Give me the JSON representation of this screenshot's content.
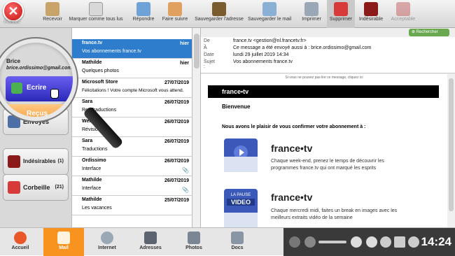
{
  "toolbar": {
    "close_label": "Fermer",
    "items": [
      {
        "label": "Recevoir",
        "icon": "receive-icon",
        "enabled": true
      },
      {
        "label": "Marquer comme tous lus",
        "icon": "mark-read-icon",
        "enabled": true
      },
      {
        "label": "Répondre",
        "icon": "reply-icon",
        "enabled": true
      },
      {
        "label": "Faire suivre",
        "icon": "forward-icon",
        "enabled": true
      },
      {
        "label": "Sauvegarder l'adresse",
        "icon": "save-address-icon",
        "enabled": true
      },
      {
        "label": "Sauvegarder le mail",
        "icon": "save-mail-icon",
        "enabled": true
      },
      {
        "label": "Imprimer",
        "icon": "printer-icon",
        "enabled": true
      },
      {
        "label": "Supprimer",
        "icon": "trash-icon",
        "enabled": true
      },
      {
        "label": "Indésirable",
        "icon": "spam-icon",
        "enabled": true
      },
      {
        "label": "Acceptable",
        "icon": "not-spam-icon",
        "enabled": false
      }
    ]
  },
  "account": {
    "name": "Brice",
    "email": "brice.ordissimo@gmail.com"
  },
  "folders": {
    "ecrire": "Ecrire",
    "recus": "Reçus",
    "envoyes": "Envoyés",
    "indesirables": "Indésirables",
    "indesirables_count": "(1)",
    "corbeille": "Corbeille",
    "corbeille_count": "(21)"
  },
  "mails": [
    {
      "from": "france.tv",
      "date": "hier",
      "subject": "Vos abonnements france.tv",
      "attachment": false
    },
    {
      "from": "Mathilde",
      "date": "hier",
      "subject": "Quelques photos",
      "attachment": false
    },
    {
      "from": "Microsoft Store",
      "date": "27/07/2019",
      "subject": "Félicitations ! Votre compte Microsoft vous attend.",
      "attachment": false
    },
    {
      "from": "Sara",
      "date": "26/07/2019",
      "subject": "Re: Traductions",
      "attachment": false
    },
    {
      "from": "Wendy",
      "date": "26/07/2019",
      "subject": "Révision",
      "attachment": false
    },
    {
      "from": "Sara",
      "date": "26/07/2019",
      "subject": "Traductions",
      "attachment": false
    },
    {
      "from": "Ordissimo",
      "date": "26/07/2019",
      "subject": "Interface",
      "attachment": true
    },
    {
      "from": "Mathilde",
      "date": "26/07/2019",
      "subject": "Interface",
      "attachment": true
    },
    {
      "from": "Mathilde",
      "date": "25/07/2019",
      "subject": "Les vacances",
      "attachment": false
    }
  ],
  "search_label": "Rechercher",
  "reading": {
    "labels": {
      "from": "De :",
      "to": "À :",
      "date": "Date :",
      "subject": "Sujet :"
    },
    "from": "france.tv <gestion@nl.francetv.fr>",
    "to": "Ce message a été envoyé aussi à : brice.ordissimo@gmail.com",
    "date": "lundi 29 juillet 2019 14:34",
    "subject": "Vos abonnements france.tv",
    "body": {
      "notice": "Si vous ne pouvez pas lire ce message, cliquez ici",
      "brand": "france•tv",
      "welcome": "Bienvenue",
      "intro": "Nous avons le plaisir de vous confirmer votre abonnement à :",
      "promo1_brand": "france•tv",
      "promo1_text": "Chaque week-end, prenez le temps de découvrir les programmes france.tv qui ont marqué les esprits",
      "promo2_brand": "france•tv",
      "promo2_badge_top": "LA PAUSE",
      "promo2_badge_bottom": "VIDEO",
      "promo2_text": "Chaque mercredi midi, faites un break en images avec les meilleurs extraits vidéo de la semaine"
    }
  },
  "taskbar": {
    "items": [
      {
        "label": "Accueil",
        "icon": "home-icon",
        "active": false
      },
      {
        "label": "Mail",
        "icon": "mail-icon",
        "active": true
      },
      {
        "label": "Internet",
        "icon": "globe-icon",
        "active": false
      },
      {
        "label": "Adresses",
        "icon": "contacts-icon",
        "active": false
      },
      {
        "label": "Photos",
        "icon": "camera-icon",
        "active": false
      },
      {
        "label": "Docs",
        "icon": "docs-icon",
        "active": false
      }
    ],
    "time": "14:24"
  },
  "colors": {
    "selected_mail": "#2e7dcc",
    "ecrire": "#3a34d0",
    "recus": "#f5a54a",
    "active_tab": "#f7931e",
    "search": "#6aa84f"
  }
}
